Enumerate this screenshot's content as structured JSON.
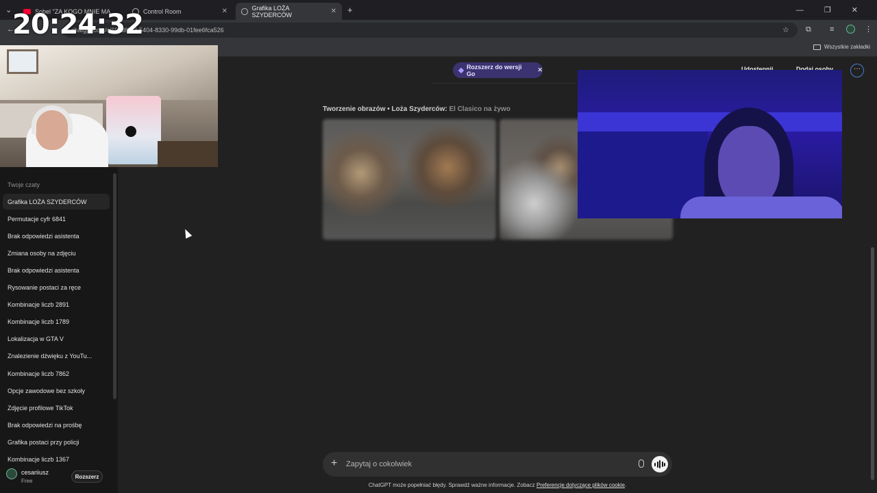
{
  "browser": {
    "tabs": [
      {
        "title": "Sobel \"ZA KOGO MNIE MA",
        "icon": "youtube-icon"
      },
      {
        "title": "Control Room",
        "icon": "globe-icon"
      },
      {
        "title": "Grafika LOŻA SZYDERCÓW",
        "icon": "chatgpt-icon"
      }
    ],
    "new_tab_label": "+",
    "url": "chatgpt.com/c/6963f223-5404-8330-99db-01fee6fca526",
    "bookmarks_all_label": "Wszystkie zakładki"
  },
  "overlay": {
    "clock": "20:24:32"
  },
  "sidebar": {
    "chats_heading": "Twoje czaty",
    "items": [
      "Grafika LOŻA SZYDERCÓW",
      "Permutacje cyfr 6841",
      "Brak odpowiedzi asistenta",
      "Zmiana osoby na zdjęciu",
      "Brak odpowiedzi asistenta",
      "Rysowanie postaci za ręce",
      "Kombinacje liczb 2891",
      "Kombinacje liczb 1789",
      "Lokalizacja w GTA V",
      "Znalezienie dźwięku z YouTu...",
      "Kombinacje liczb 7862",
      "Opcje zawodowe bez szkoły",
      "Zdjęcie profilowe TikTok",
      "Brak odpowiedzi na prośbę",
      "Grafika postaci przy policji",
      "Kombinacje liczb 1367"
    ],
    "user": {
      "name": "cesariiusz",
      "plan": "Free",
      "upgrade_label": "Rozszerz"
    }
  },
  "main": {
    "upgrade_pill": "Rozszerz do wersji Go",
    "share_label": "Udostępnij",
    "add_people_label": "Dodaj osoby",
    "images_title": "Tworzenie obrazów • Loża Szyderców:",
    "images_subtitle": "El Clasico na żywo",
    "composer_placeholder": "Zapytaj o cokolwiek",
    "disclaimer": "ChatGPT może popełniać błędy. Sprawdź ważne informacje. Zobacz",
    "disclaimer_link": "Preferencje dotyczące plików cookie",
    "disclaimer_end": "."
  },
  "colors": {
    "accent_pill": "#3b3270",
    "sidebar_bg": "#171717",
    "main_bg": "#212121"
  }
}
